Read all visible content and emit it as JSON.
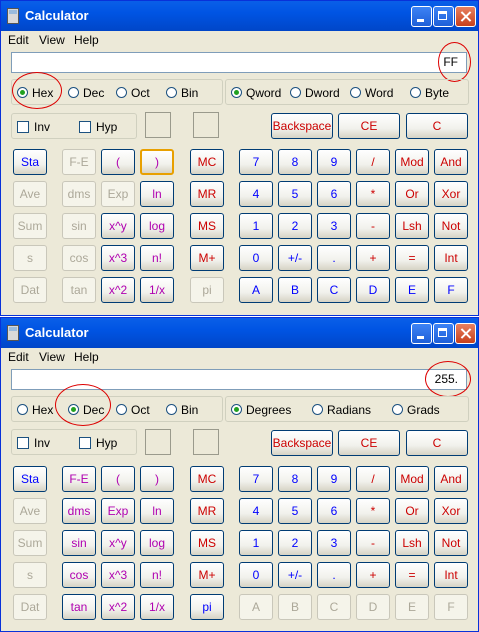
{
  "window1": {
    "title": "Calculator",
    "menu": [
      "Edit",
      "View",
      "Help"
    ],
    "display": "FF",
    "base_radios": [
      {
        "label": "Hex",
        "selected": true
      },
      {
        "label": "Dec",
        "selected": false
      },
      {
        "label": "Oct",
        "selected": false
      },
      {
        "label": "Bin",
        "selected": false
      }
    ],
    "size_radios": [
      {
        "label": "Qword",
        "selected": true
      },
      {
        "label": "Dword",
        "selected": false
      },
      {
        "label": "Word",
        "selected": false
      },
      {
        "label": "Byte",
        "selected": false
      }
    ],
    "checks": [
      "Inv",
      "Hyp"
    ],
    "edit_buttons": [
      "Backspace",
      "CE",
      "C"
    ],
    "sci_left": [
      [
        "Sta",
        "Ave",
        "Sum",
        "s",
        "Dat"
      ],
      [
        "F-E",
        "dms",
        "Exp",
        "ln",
        "pi"
      ]
    ],
    "sci_mid": [
      [
        "(",
        "sin",
        "x^y",
        "x^3",
        "x^2"
      ],
      [
        ")",
        "cos",
        "log",
        "n!",
        "1/x"
      ]
    ],
    "sci_col2": [
      "F-E",
      "dms",
      "sin",
      "cos",
      "tan"
    ],
    "memory": [
      "MC",
      "MR",
      "MS",
      "M+",
      "pi"
    ],
    "keypad": [
      [
        "7",
        "8",
        "9",
        "/",
        "Mod",
        "And"
      ],
      [
        "4",
        "5",
        "6",
        "*",
        "Or",
        "Xor"
      ],
      [
        "1",
        "2",
        "3",
        "-",
        "Lsh",
        "Not"
      ],
      [
        "0",
        "+/-",
        ".",
        "+",
        "=",
        "Int"
      ],
      [
        "A",
        "B",
        "C",
        "D",
        "E",
        "F"
      ]
    ]
  },
  "window2": {
    "title": "Calculator",
    "menu": [
      "Edit",
      "View",
      "Help"
    ],
    "display": "255.",
    "base_radios": [
      {
        "label": "Hex",
        "selected": false
      },
      {
        "label": "Dec",
        "selected": true
      },
      {
        "label": "Oct",
        "selected": false
      },
      {
        "label": "Bin",
        "selected": false
      }
    ],
    "angle_radios": [
      {
        "label": "Degrees",
        "selected": true
      },
      {
        "label": "Radians",
        "selected": false
      },
      {
        "label": "Grads",
        "selected": false
      }
    ],
    "checks": [
      "Inv",
      "Hyp"
    ],
    "edit_buttons": [
      "Backspace",
      "CE",
      "C"
    ]
  }
}
